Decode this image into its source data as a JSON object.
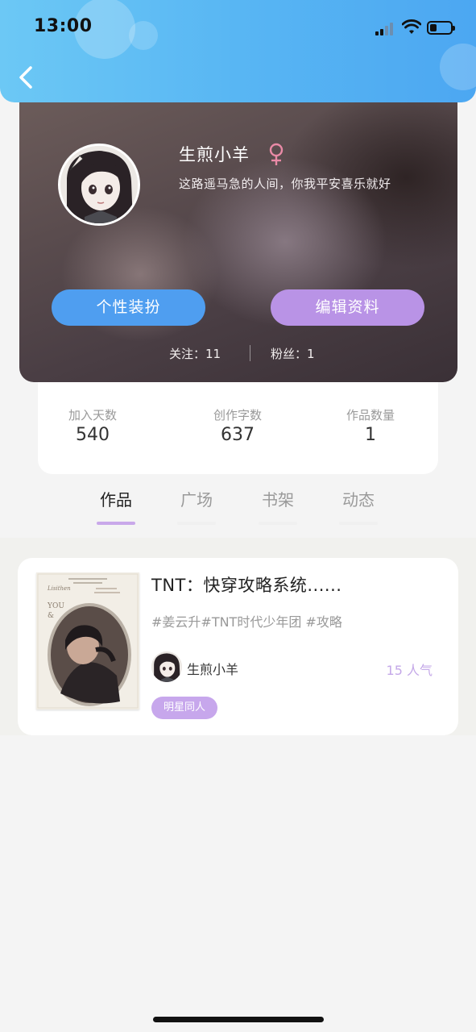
{
  "status_bar": {
    "time": "13:00"
  },
  "profile": {
    "username": "生煎小羊",
    "bio": "这路遥马急的人间，你我平安喜乐就好",
    "dress_button": "个性装扮",
    "edit_button": "编辑资料",
    "follow_label": "关注：",
    "follow_count": "11",
    "fans_label": "粉丝：",
    "fans_count": "1"
  },
  "stats": [
    {
      "label": "加入天数",
      "value": "540"
    },
    {
      "label": "创作字数",
      "value": "637"
    },
    {
      "label": "作品数量",
      "value": "1"
    }
  ],
  "tabs": [
    {
      "label": "作品",
      "active": true
    },
    {
      "label": "广场",
      "active": false
    },
    {
      "label": "书架",
      "active": false
    },
    {
      "label": "动态",
      "active": false
    }
  ],
  "works": [
    {
      "title": "TNT：快穿攻略系统......",
      "tags": "#姜云升#TNT时代少年团 #攻略",
      "author": "生煎小羊",
      "popularity": "15 人气",
      "category": "明星同人"
    }
  ],
  "colors": {
    "header_gradient_start": "#6cc8f5",
    "header_gradient_end": "#4ca7f2",
    "dress_button": "#4f9ef0",
    "edit_button": "#b993e6",
    "tab_indicator": "#c9a8ea",
    "category_badge": "#c7a7ec",
    "popularity": "#c4a8e8"
  }
}
